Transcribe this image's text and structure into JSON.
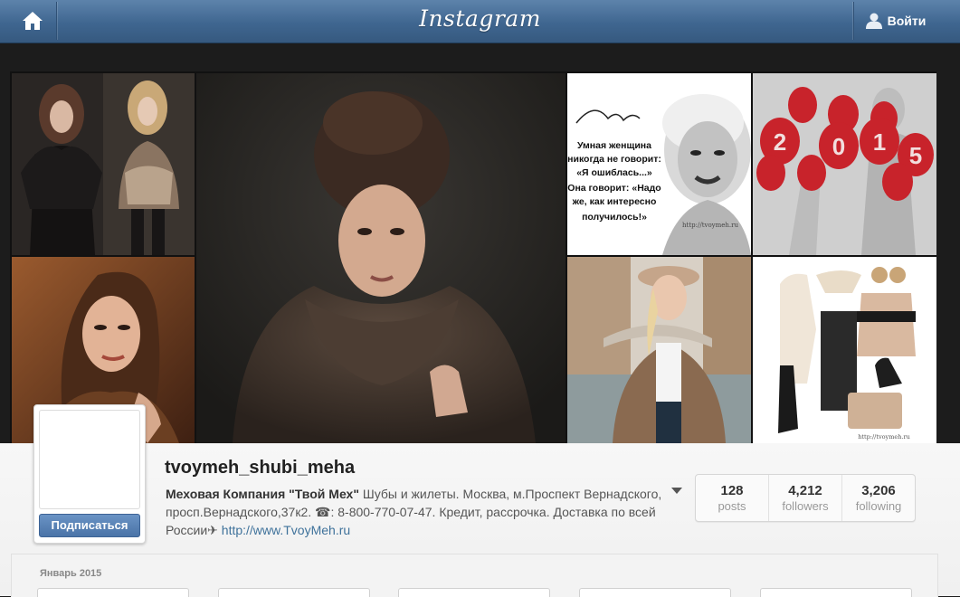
{
  "header": {
    "logo": "Instagram",
    "login_label": "Войти"
  },
  "banner": {
    "tiles": [
      {
        "name": "runway-furs-photo"
      },
      {
        "name": "woman-fur-coat-photo"
      },
      {
        "name": "marilyn-quote-photo"
      },
      {
        "name": "balloons-2015-photo"
      },
      {
        "name": "sable-fur-portrait-photo"
      },
      {
        "name": "venice-fur-photo"
      },
      {
        "name": "fur-vest-collage-photo"
      }
    ],
    "quote_lines": [
      "Умная женщина",
      "никогда не говорит:",
      "«Я ошиблась...»",
      "Она говорит: «Надо",
      "же, как интересно",
      "получилось!»"
    ],
    "quote_site": "http://tvoymeh.ru",
    "balloon_year": [
      "2",
      "0",
      "1",
      "5"
    ],
    "collage_site": "http://tvoymeh.ru"
  },
  "profile": {
    "subscribe_label": "Подписаться",
    "username": "tvoymeh_shubi_meha",
    "bio_name": "Меховая Компания \"Твой Мех\"",
    "bio_text": " Шубы и жилеты. Москва, м.Проспект Вернадского, просп.Вернадского,37к2. ☎: 8-800-770-07-47. Кредит, рассрочка. Доставка по всей России✈ ",
    "bio_link": "http://www.TvoyMeh.ru"
  },
  "stats": [
    {
      "value": "128",
      "label": "posts"
    },
    {
      "value": "4,212",
      "label": "followers"
    },
    {
      "value": "3,206",
      "label": "following"
    }
  ],
  "feed": {
    "month_label": "Январь 2015"
  },
  "colors": {
    "topbar": "#3f6690",
    "subscribe": "#4a73a7",
    "link": "#3f729b",
    "balloon": "#c8232b"
  }
}
